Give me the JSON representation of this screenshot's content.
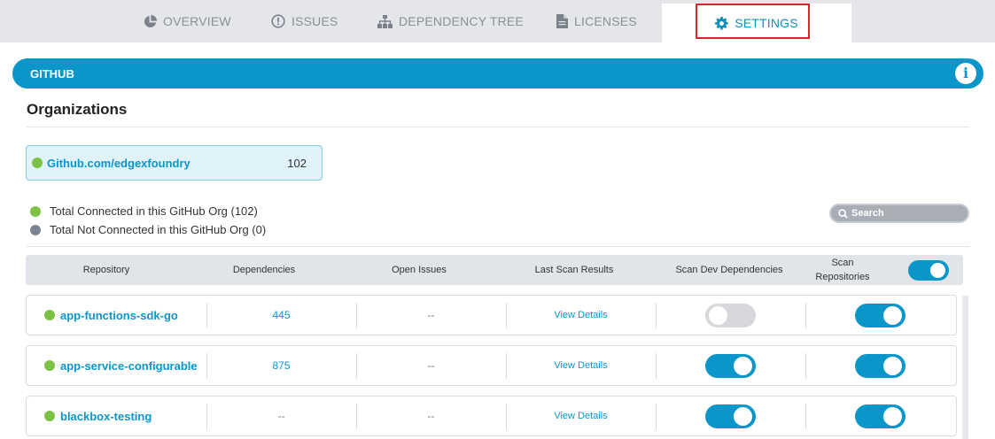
{
  "tabs": [
    {
      "label": "OVERVIEW",
      "icon": "pie-chart-icon"
    },
    {
      "label": "ISSUES",
      "icon": "alert-circle-icon"
    },
    {
      "label": "DEPENDENCY TREE",
      "icon": "sitemap-icon"
    },
    {
      "label": "LICENSES",
      "icon": "document-icon"
    },
    {
      "label": "SETTINGS",
      "icon": "gear-icon",
      "active": true
    }
  ],
  "section": {
    "title": "GITHUB",
    "info_icon": "info-icon"
  },
  "organizations": {
    "heading": "Organizations",
    "org": {
      "name": "Github.com/edgexfoundry",
      "count": "102",
      "status_color": "#7dc144"
    }
  },
  "legend": {
    "connected": "Total Connected in this GitHub Org (102)",
    "not_connected": "Total Not Connected in this GitHub Org (0)"
  },
  "search": {
    "placeholder": "Search"
  },
  "table": {
    "headers": {
      "repository": "Repository",
      "dependencies": "Dependencies",
      "open_issues": "Open Issues",
      "last_scan": "Last Scan Results",
      "scan_dev": "Scan Dev Dependencies",
      "scan_repos": "Scan Repositories"
    },
    "scan_all_toggle": true,
    "rows": [
      {
        "name": "app-functions-sdk-go",
        "dependencies": "445",
        "open_issues": "--",
        "last_scan": "View Details",
        "scan_dev": false,
        "scan_repo": true
      },
      {
        "name": "app-service-configurable",
        "dependencies": "875",
        "open_issues": "--",
        "last_scan": "View Details",
        "scan_dev": true,
        "scan_repo": true
      },
      {
        "name": "blackbox-testing",
        "dependencies": "--",
        "open_issues": "--",
        "last_scan": "View Details",
        "scan_dev": true,
        "scan_repo": true
      }
    ]
  },
  "colors": {
    "accent": "#0a96c9",
    "connected": "#7dc144",
    "not_connected": "#7d8594",
    "highlight": "#d9262c"
  }
}
